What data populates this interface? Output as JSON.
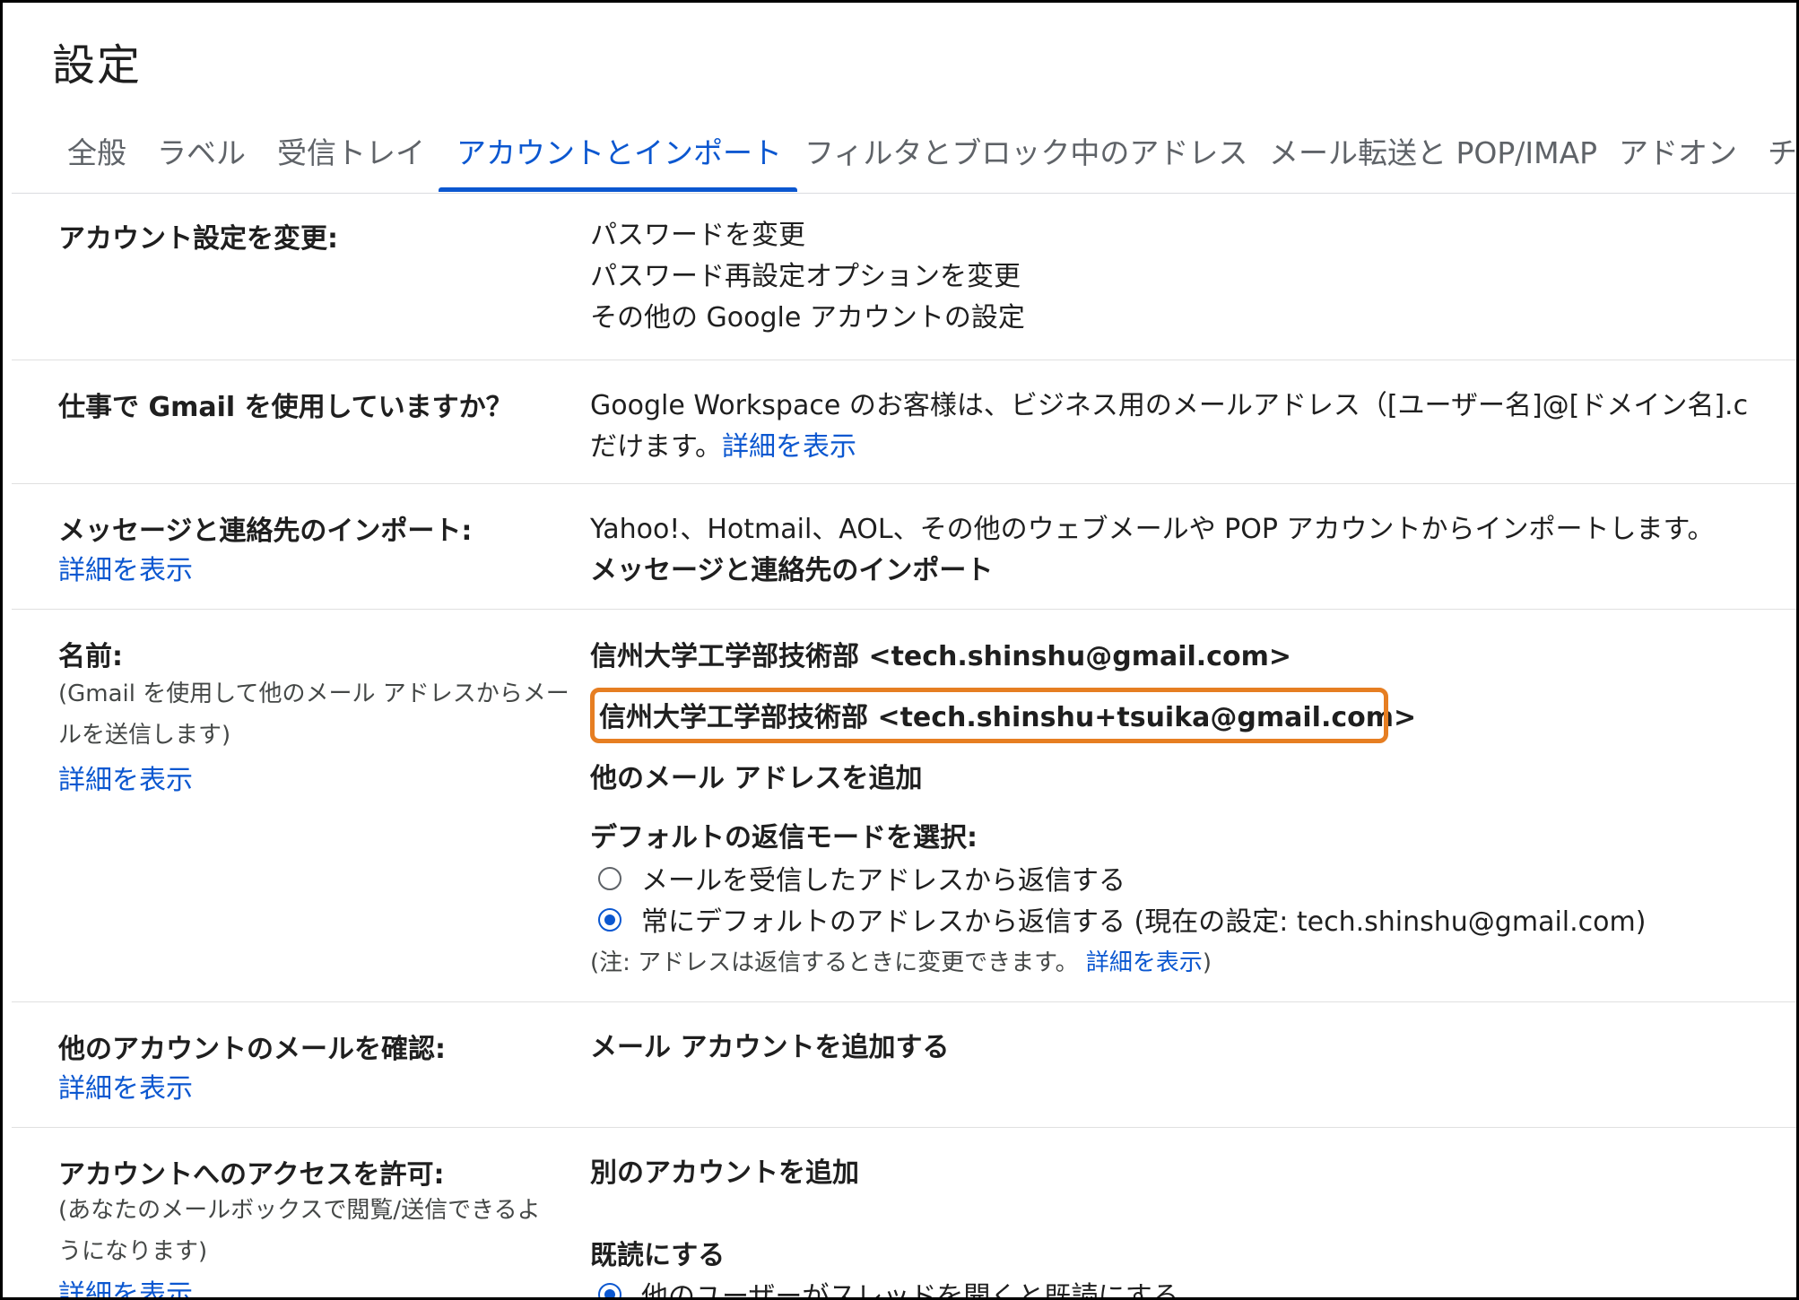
{
  "page_title": "設定",
  "tabs": [
    {
      "label": "全般"
    },
    {
      "label": "ラベル"
    },
    {
      "label": "受信トレイ"
    },
    {
      "label": "アカウントとインポート",
      "active": true
    },
    {
      "label": "フィルタとブロック中のアドレス"
    },
    {
      "label": "メール転送と POP/IMAP"
    },
    {
      "label": "アドオン"
    },
    {
      "label": "チ"
    }
  ],
  "account_settings": {
    "label": "アカウント設定を変更:",
    "links": [
      "パスワードを変更",
      "パスワード再設定オプションを変更",
      "その他の Google アカウントの設定"
    ]
  },
  "workspace": {
    "label": "仕事で Gmail を使用していますか？",
    "text_line1": "Google Workspace のお客様は、ビジネス用のメールアドレス（[ユーザー名]@[ドメイン名].c",
    "text_line2": "だけます。",
    "link": "詳細を表示"
  },
  "import": {
    "label": "メッセージと連絡先のインポート:",
    "learn_more": "詳細を表示",
    "text": "Yahoo!、Hotmail、AOL、その他のウェブメールや POP アカウントからインポートします。",
    "action": "メッセージと連絡先のインポート"
  },
  "name": {
    "label": "名前:",
    "sub_line1": "(Gmail を使用して他のメール アドレスからメー",
    "sub_line2": "ルを送信します)",
    "learn_more": "詳細を表示",
    "addresses": [
      "信州大学工学部技術部 <tech.shinshu@gmail.com>",
      "信州大学工学部技術部 <tech.shinshu+tsuika@gmail.com>"
    ],
    "add_address": "他のメール アドレスを追加",
    "reply_mode_label": "デフォルトの返信モードを選択:",
    "reply_option1": "メールを受信したアドレスから返信する",
    "reply_option2": "常にデフォルトのアドレスから返信する (現在の設定: tech.shinshu@gmail.com)",
    "note_prefix": "(注: アドレスは返信するときに変更できます。",
    "note_link": "詳細を表示",
    "note_suffix": ")"
  },
  "check_mail": {
    "label": "他のアカウントのメールを確認:",
    "learn_more": "詳細を表示",
    "action": "メール アカウントを追加する"
  },
  "grant_access": {
    "label": "アカウントへのアクセスを許可:",
    "sub_line1": "(あなたのメールボックスで閲覧/送信できるよ",
    "sub_line2": "うになります)",
    "learn_more": "詳細を表示",
    "action": "別のアカウントを追加",
    "mark_read_label": "既読にする",
    "mark_read_option": "他のユーザーがスレッドを開くと既読にする"
  }
}
